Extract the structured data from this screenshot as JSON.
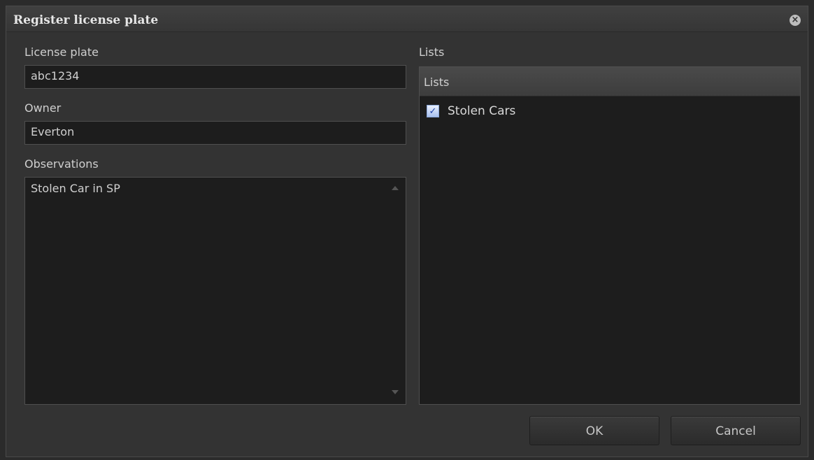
{
  "dialog": {
    "title": "Register license plate"
  },
  "form": {
    "license_plate_label": "License plate",
    "license_plate_value": "abc1234",
    "owner_label": "Owner",
    "owner_value": "Everton",
    "observations_label": "Observations",
    "observations_value": "Stolen Car in SP"
  },
  "lists": {
    "label": "Lists",
    "header": "Lists",
    "items": [
      {
        "label": "Stolen Cars",
        "checked": true
      }
    ]
  },
  "buttons": {
    "ok": "OK",
    "cancel": "Cancel"
  },
  "icons": {
    "close": "close-icon",
    "check": "checkmark-icon",
    "scroll_up": "scroll-up-arrow-icon",
    "scroll_down": "scroll-down-arrow-icon"
  },
  "colors": {
    "dialog_bg": "#333333",
    "field_bg": "#1d1d1d",
    "text": "#c8c8c8",
    "checkbox_accent": "#1b3fa6"
  }
}
